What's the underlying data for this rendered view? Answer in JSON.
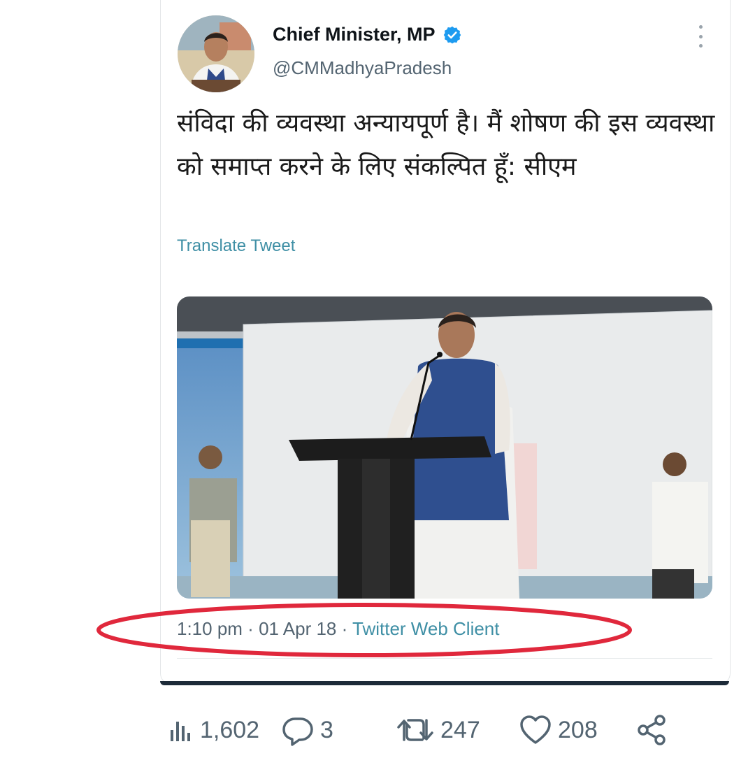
{
  "tweet": {
    "author_name": "Chief Minister, MP",
    "handle": "@CMMadhyaPradesh",
    "text": "संविदा की व्यवस्था अन्यायपूर्ण है। मैं शोषण की इस व्यवस्था को समाप्त करने के लिए संकल्पित हूँ: सीएम",
    "translate_label": "Translate Tweet",
    "time": "1:10 pm",
    "separator": " · ",
    "date": "01 Apr 18",
    "client": "Twitter Web Client"
  },
  "actions": {
    "views": "1,602",
    "replies": "3",
    "retweets": "247",
    "likes": "208"
  },
  "colors": {
    "verified": "#1d9bf0",
    "link": "#3f8fa5",
    "highlight_ellipse": "#e0283c",
    "secondary_text": "#536471"
  },
  "icons": [
    "verified-badge-icon",
    "more-options-icon",
    "views-icon",
    "reply-icon",
    "retweet-icon",
    "like-icon",
    "share-icon"
  ]
}
